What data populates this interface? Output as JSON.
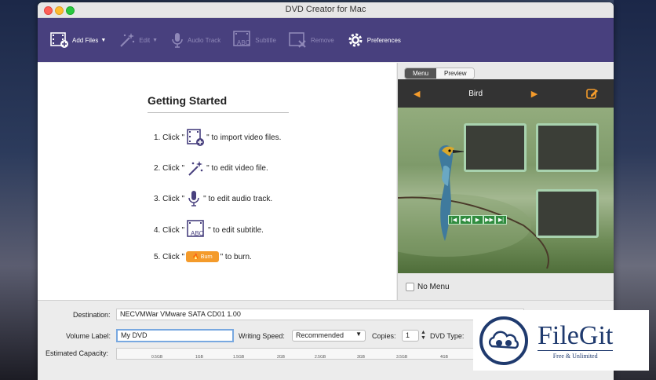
{
  "window": {
    "title": "DVD Creator for Mac"
  },
  "toolbar": {
    "add_files": "Add Files",
    "edit": "Edit",
    "audio_track": "Audio Track",
    "subtitle": "Subtitle",
    "remove": "Remove",
    "preferences": "Preferences"
  },
  "getting_started": {
    "title": "Getting Started",
    "steps": [
      {
        "prefix": "1. Click \"",
        "suffix": "\" to import video files."
      },
      {
        "prefix": "2. Click \"",
        "suffix": "\" to edit video file."
      },
      {
        "prefix": "3. Click \"",
        "suffix": "\" to edit audio track."
      },
      {
        "prefix": "4. Click \"",
        "suffix": "\" to edit subtitle."
      },
      {
        "prefix": "5. Click \"",
        "suffix": "\" to burn."
      }
    ],
    "burn_label": "Burn"
  },
  "preview_panel": {
    "tabs": [
      "Menu",
      "Preview"
    ],
    "active_tab": "Menu",
    "theme_name": "Bird",
    "no_menu_label": "No Menu"
  },
  "settings": {
    "destination_label": "Destination:",
    "destination_value": "NECVMWar VMware SATA CD01 1.00",
    "volume_label_label": "Volume Label:",
    "volume_label_value": "My DVD",
    "writing_speed_label": "Writing Speed:",
    "writing_speed_value": "Recommended",
    "copies_label": "Copies:",
    "copies_value": "1",
    "dvd_type_label": "DVD Type:",
    "estimated_capacity_label": "Estimated Capacity:",
    "capacity_ticks": [
      "0.5GB",
      "1GB",
      "1.5GB",
      "2GB",
      "2.5GB",
      "3GB",
      "3.5GB",
      "4GB"
    ]
  },
  "watermark": {
    "name": "FileGit",
    "tagline": "Free & Unlimited"
  },
  "colors": {
    "toolbar": "#48407e",
    "accent": "#f49b2b"
  }
}
